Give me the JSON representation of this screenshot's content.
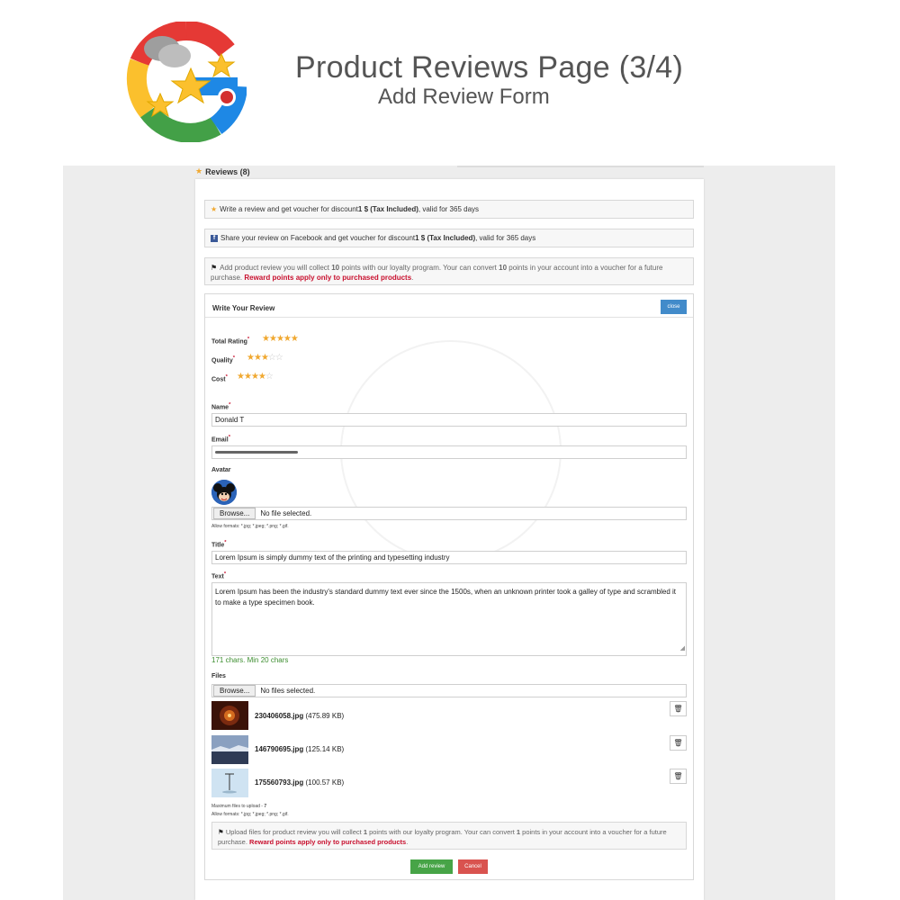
{
  "banner": {
    "title": "Product Reviews Page (3/4)",
    "subtitle": "Add Review Form"
  },
  "reviews_header": {
    "label": "Reviews (8)"
  },
  "notes": {
    "review_voucher": {
      "pre": "Write a review and get voucher for discount ",
      "bold": "1 $ (Tax Included)",
      "post": " , valid for 365 days"
    },
    "facebook_voucher": {
      "pre": "Share your review on Facebook and get voucher for discount ",
      "bold": "1 $ (Tax Included)",
      "post": " , valid for 365 days"
    },
    "loyalty": {
      "pre": "Add product review you will collect ",
      "points1": "10",
      "mid": " points with our loyalty program. Your can convert ",
      "points2": "10",
      "post": " points in your account into a voucher for a future purchase. ",
      "red": "Reward points apply only to purchased products",
      "end": "."
    }
  },
  "form": {
    "title": "Write Your Review",
    "close_label": "close",
    "ratings": [
      {
        "label": "Total Rating",
        "value": 5,
        "max": 5
      },
      {
        "label": "Quality",
        "value": 3,
        "max": 5
      },
      {
        "label": "Cost",
        "value": 4,
        "max": 5
      }
    ],
    "required_mark": "*",
    "name_label": "Name",
    "name_value": "Donald T",
    "email_label": "Email",
    "avatar_label": "Avatar",
    "browse_label": "Browse...",
    "no_file": "No file selected.",
    "avatar_formats": "Allow formats: *.jpg; *.jpeg; *.png; *.gif.",
    "title_label": "Title",
    "title_value": "Lorem Ipsum is simply dummy text of the printing and typesetting industry",
    "text_label": "Text",
    "text_value": "Lorem Ipsum has been the industry's standard dummy text ever since the 1500s, when an unknown printer took a galley of type and scrambled it to make a type specimen book.",
    "char_counter": "171 chars. Min 20 chars",
    "files_label": "Files",
    "no_files": "No files selected.",
    "files": [
      {
        "name": "230406058.jpg",
        "size": "(475.89 KB)"
      },
      {
        "name": "146790695.jpg",
        "size": "(125.14 KB)"
      },
      {
        "name": "175560793.jpg",
        "size": "(100.57 KB)"
      }
    ],
    "max_files": "Maximum files to upload - ",
    "max_files_value": "7",
    "file_formats": "Allow formats: *.jpg; *.jpeg; *.png; *.gif.",
    "upload_note": {
      "pre": "Upload files for product review you will collect ",
      "points1": "1",
      "mid": " points with our loyalty program. Your can convert ",
      "points2": "1",
      "post": " points in your account into a voucher for a future purchase. ",
      "red": "Reward points apply only to purchased products",
      "end": "."
    },
    "add_label": "Add review",
    "cancel_label": "Cancel"
  },
  "colors": {
    "accent_blue": "#428bca",
    "star": "#f0a830",
    "success": "#47a447",
    "danger": "#d9534f",
    "warning_text": "#c8102e",
    "counter_green": "#3c8d2f"
  }
}
